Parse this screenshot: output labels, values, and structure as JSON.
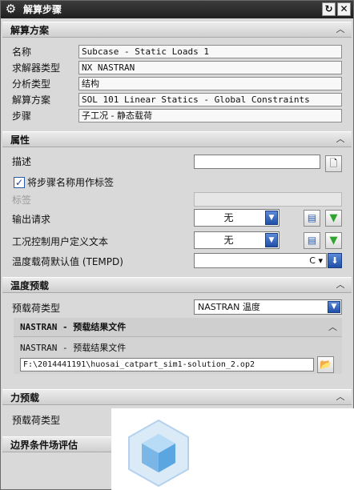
{
  "window": {
    "title": "解算步骤",
    "buttons": {
      "reset": "↻",
      "close": "✕"
    }
  },
  "solution_section": {
    "header": "解算方案",
    "rows": [
      {
        "label": "名称",
        "value": "Subcase - Static Loads 1"
      },
      {
        "label": "求解器类型",
        "value": "NX NASTRAN"
      },
      {
        "label": "分析类型",
        "value": "结构"
      },
      {
        "label": "解算方案",
        "value": "SOL 101 Linear Statics - Global Constraints"
      },
      {
        "label": "步骤",
        "value": "子工况 - 静态载荷"
      }
    ]
  },
  "properties_section": {
    "header": "属性",
    "description_label": "描述",
    "description_value": "",
    "use_step_name_checkbox": {
      "label": "将步骤名称用作标签",
      "checked": true
    },
    "tag_label": "标签",
    "output_request": {
      "label": "输出请求",
      "value": "无"
    },
    "case_control": {
      "label": "工况控制用户定义文本",
      "value": "无"
    },
    "temp_default": {
      "label": "温度载荷默认值 (TEMPD)",
      "value": "",
      "unit": "C"
    }
  },
  "temperature_preload_section": {
    "header": "温度预载",
    "preload_type": {
      "label": "预载荷类型",
      "value": "NASTRAN 温度"
    },
    "sub_group": {
      "header": "NASTRAN - 预载结果文件",
      "field_label": "NASTRAN - 预载结果文件",
      "file_path": "F:\\2014441191\\huosai_catpart_sim1-solution_2.op2"
    }
  },
  "force_preload_section": {
    "header": "力预载",
    "preload_type_label": "预载荷类型"
  },
  "boundary_section": {
    "header": "边界条件场评估"
  }
}
